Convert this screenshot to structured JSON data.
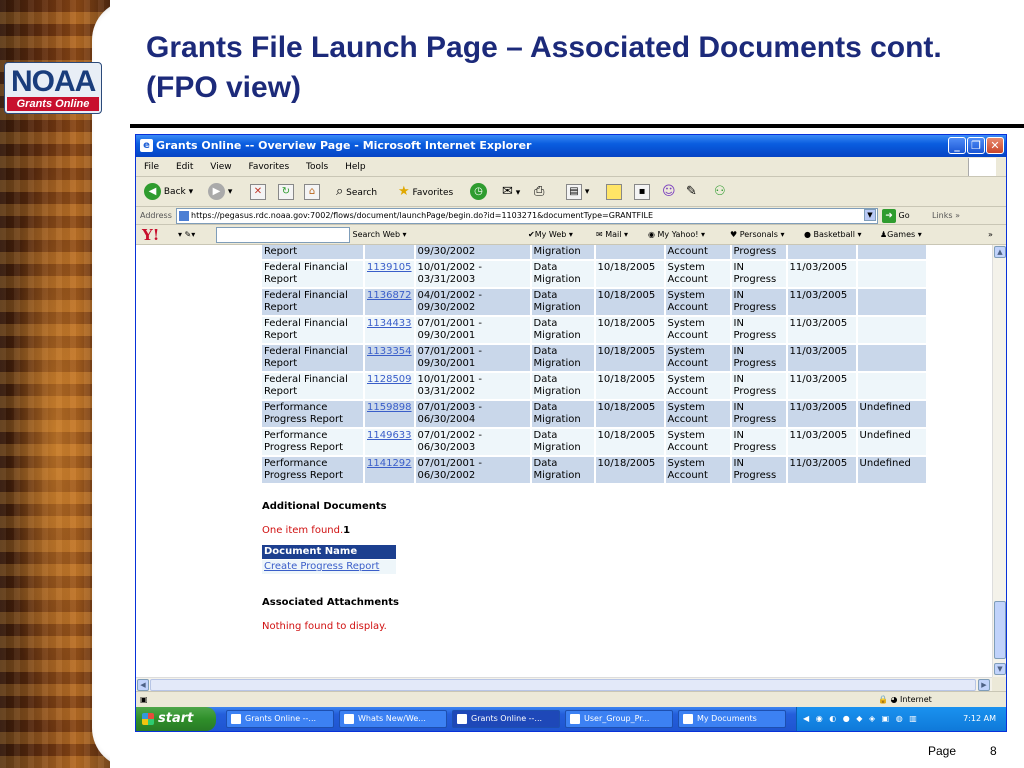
{
  "slide": {
    "title": "Grants File Launch Page – Associated Documents cont.  (FPO view)",
    "logo_text": "NOAA",
    "logo_sub": "Grants Online",
    "footer_label": "Page",
    "page_number": "8"
  },
  "browser": {
    "window_title": "Grants Online -- Overview Page - Microsoft Internet Explorer",
    "menu": [
      "File",
      "Edit",
      "View",
      "Favorites",
      "Tools",
      "Help"
    ],
    "toolbar": {
      "back": "Back",
      "search": "Search",
      "favorites": "Favorites"
    },
    "address_label": "Address",
    "url": "https://pegasus.rdc.noaa.gov:7002/flows/document/launchPage/begin.do?id=1103271&documentType=GRANTFILE",
    "go_label": "Go",
    "links_label": "Links",
    "yahoo": {
      "logo": "Y!",
      "search_btn": "Search Web",
      "items": [
        "My Web",
        "Mail",
        "My Yahoo!",
        "Personals",
        "Basketball",
        "Games"
      ]
    },
    "status_zone": "Internet"
  },
  "table": {
    "partial_row": [
      "Report",
      "",
      "09/30/2002",
      "Migration",
      "",
      "Account",
      "Progress",
      "",
      ""
    ],
    "rows": [
      {
        "doc": "Federal Financial Report",
        "id": "1139105",
        "period": "10/01/2002 - 03/31/2003",
        "origin": "Data Migration",
        "created": "10/18/2005",
        "by": "System Account",
        "status": "IN Progress",
        "date": "11/03/2005",
        "type": ""
      },
      {
        "doc": "Federal Financial Report",
        "id": "1136872",
        "period": "04/01/2002 - 09/30/2002",
        "origin": "Data Migration",
        "created": "10/18/2005",
        "by": "System Account",
        "status": "IN Progress",
        "date": "11/03/2005",
        "type": ""
      },
      {
        "doc": "Federal Financial Report",
        "id": "1134433",
        "period": "07/01/2001 - 09/30/2001",
        "origin": "Data Migration",
        "created": "10/18/2005",
        "by": "System Account",
        "status": "IN Progress",
        "date": "11/03/2005",
        "type": ""
      },
      {
        "doc": "Federal Financial Report",
        "id": "1133354",
        "period": "07/01/2001 - 09/30/2001",
        "origin": "Data Migration",
        "created": "10/18/2005",
        "by": "System Account",
        "status": "IN Progress",
        "date": "11/03/2005",
        "type": ""
      },
      {
        "doc": "Federal Financial Report",
        "id": "1128509",
        "period": "10/01/2001 - 03/31/2002",
        "origin": "Data Migration",
        "created": "10/18/2005",
        "by": "System Account",
        "status": "IN Progress",
        "date": "11/03/2005",
        "type": ""
      },
      {
        "doc": "Performance Progress Report",
        "id": "1159898",
        "period": "07/01/2003 - 06/30/2004",
        "origin": "Data Migration",
        "created": "10/18/2005",
        "by": "System Account",
        "status": "IN Progress",
        "date": "11/03/2005",
        "type": "Undefined"
      },
      {
        "doc": "Performance Progress Report",
        "id": "1149633",
        "period": "07/01/2002 - 06/30/2003",
        "origin": "Data Migration",
        "created": "10/18/2005",
        "by": "System Account",
        "status": "IN Progress",
        "date": "11/03/2005",
        "type": "Undefined"
      },
      {
        "doc": "Performance Progress Report",
        "id": "1141292",
        "period": "07/01/2001 - 06/30/2002",
        "origin": "Data Migration",
        "created": "10/18/2005",
        "by": "System Account",
        "status": "IN Progress",
        "date": "11/03/2005",
        "type": "Undefined"
      }
    ]
  },
  "additional": {
    "heading": "Additional Documents",
    "found_text": "One item found.",
    "found_count": "1",
    "column_header": "Document Name",
    "link": "Create Progress Report"
  },
  "attachments": {
    "heading": "Associated Attachments",
    "empty_text": "Nothing found to display."
  },
  "taskbar": {
    "start": "start",
    "tasks": [
      "Grants Online --...",
      "Whats New/We...",
      "Grants Online --...",
      "User_Group_Pr...",
      "My Documents"
    ],
    "clock": "7:12 AM"
  }
}
